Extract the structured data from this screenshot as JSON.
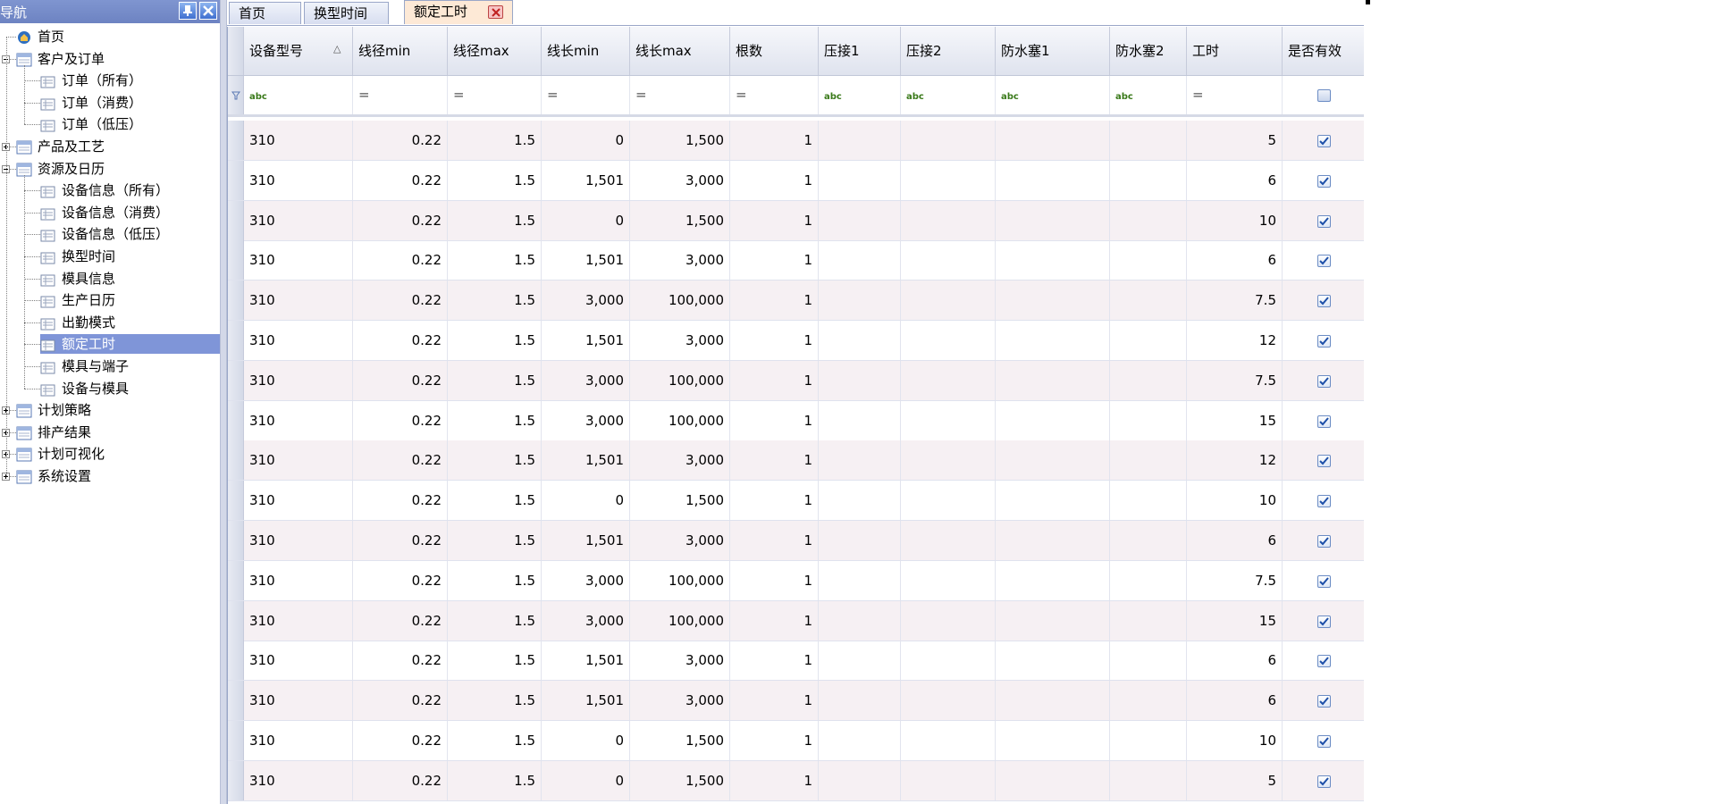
{
  "nav": {
    "title": "导航",
    "tree": [
      {
        "label": "首页",
        "level": 0,
        "icon": "home-icon"
      },
      {
        "label": "客户及订单",
        "level": 0,
        "icon": "folder-icon",
        "expanded": true
      },
      {
        "label": "订单（所有）",
        "level": 1,
        "icon": "list-icon"
      },
      {
        "label": "订单（消费）",
        "level": 1,
        "icon": "list-icon"
      },
      {
        "label": "订单（低压）",
        "level": 1,
        "icon": "list-icon"
      },
      {
        "label": "产品及工艺",
        "level": 0,
        "icon": "folder-icon",
        "expanded": false
      },
      {
        "label": "资源及日历",
        "level": 0,
        "icon": "folder-icon",
        "expanded": true
      },
      {
        "label": "设备信息（所有）",
        "level": 1,
        "icon": "list-icon"
      },
      {
        "label": "设备信息（消费）",
        "level": 1,
        "icon": "list-icon"
      },
      {
        "label": "设备信息（低压）",
        "level": 1,
        "icon": "list-icon"
      },
      {
        "label": "换型时间",
        "level": 1,
        "icon": "list-icon"
      },
      {
        "label": "模具信息",
        "level": 1,
        "icon": "list-icon"
      },
      {
        "label": "生产日历",
        "level": 1,
        "icon": "list-icon"
      },
      {
        "label": "出勤模式",
        "level": 1,
        "icon": "list-icon"
      },
      {
        "label": "额定工时",
        "level": 1,
        "icon": "list-icon",
        "selected": true
      },
      {
        "label": "模具与端子",
        "level": 1,
        "icon": "list-icon"
      },
      {
        "label": "设备与模具",
        "level": 1,
        "icon": "list-icon"
      },
      {
        "label": "计划策略",
        "level": 0,
        "icon": "folder-icon",
        "expanded": false
      },
      {
        "label": "排产结果",
        "level": 0,
        "icon": "folder-icon",
        "expanded": false
      },
      {
        "label": "计划可视化",
        "level": 0,
        "icon": "folder-icon",
        "expanded": false
      },
      {
        "label": "系统设置",
        "level": 0,
        "icon": "folder-icon",
        "expanded": false
      }
    ]
  },
  "tabs": [
    {
      "label": "首页",
      "active": false
    },
    {
      "label": "换型时间",
      "active": false
    },
    {
      "label": "额定工时",
      "active": true,
      "closable": true
    }
  ],
  "grid": {
    "columns": [
      "设备型号",
      "线径min",
      "线径max",
      "线长min",
      "线长max",
      "根数",
      "压接1",
      "压接2",
      "防水塞1",
      "防水塞2",
      "工时",
      "是否有效"
    ],
    "sort_indicator": "△",
    "filters": [
      "abc",
      "=",
      "=",
      "=",
      "=",
      "=",
      "abc",
      "abc",
      "abc",
      "abc",
      "=",
      "checkbox"
    ],
    "rows": [
      [
        "310",
        "0.22",
        "1.5",
        "0",
        "1,500",
        "1",
        "",
        "",
        "",
        "",
        "5",
        true
      ],
      [
        "310",
        "0.22",
        "1.5",
        "1,501",
        "3,000",
        "1",
        "",
        "",
        "",
        "",
        "6",
        true
      ],
      [
        "310",
        "0.22",
        "1.5",
        "0",
        "1,500",
        "1",
        "",
        "",
        "",
        "",
        "10",
        true
      ],
      [
        "310",
        "0.22",
        "1.5",
        "1,501",
        "3,000",
        "1",
        "",
        "",
        "",
        "",
        "6",
        true
      ],
      [
        "310",
        "0.22",
        "1.5",
        "3,000",
        "100,000",
        "1",
        "",
        "",
        "",
        "",
        "7.5",
        true
      ],
      [
        "310",
        "0.22",
        "1.5",
        "1,501",
        "3,000",
        "1",
        "",
        "",
        "",
        "",
        "12",
        true
      ],
      [
        "310",
        "0.22",
        "1.5",
        "3,000",
        "100,000",
        "1",
        "",
        "",
        "",
        "",
        "7.5",
        true
      ],
      [
        "310",
        "0.22",
        "1.5",
        "3,000",
        "100,000",
        "1",
        "",
        "",
        "",
        "",
        "15",
        true
      ],
      [
        "310",
        "0.22",
        "1.5",
        "1,501",
        "3,000",
        "1",
        "",
        "",
        "",
        "",
        "12",
        true
      ],
      [
        "310",
        "0.22",
        "1.5",
        "0",
        "1,500",
        "1",
        "",
        "",
        "",
        "",
        "10",
        true
      ],
      [
        "310",
        "0.22",
        "1.5",
        "1,501",
        "3,000",
        "1",
        "",
        "",
        "",
        "",
        "6",
        true
      ],
      [
        "310",
        "0.22",
        "1.5",
        "3,000",
        "100,000",
        "1",
        "",
        "",
        "",
        "",
        "7.5",
        true
      ],
      [
        "310",
        "0.22",
        "1.5",
        "3,000",
        "100,000",
        "1",
        "",
        "",
        "",
        "",
        "15",
        true
      ],
      [
        "310",
        "0.22",
        "1.5",
        "1,501",
        "3,000",
        "1",
        "",
        "",
        "",
        "",
        "6",
        true
      ],
      [
        "310",
        "0.22",
        "1.5",
        "1,501",
        "3,000",
        "1",
        "",
        "",
        "",
        "",
        "6",
        true
      ],
      [
        "310",
        "0.22",
        "1.5",
        "0",
        "1,500",
        "1",
        "",
        "",
        "",
        "",
        "10",
        true
      ],
      [
        "310",
        "0.22",
        "1.5",
        "0",
        "1,500",
        "1",
        "",
        "",
        "",
        "",
        "5",
        true
      ]
    ]
  }
}
